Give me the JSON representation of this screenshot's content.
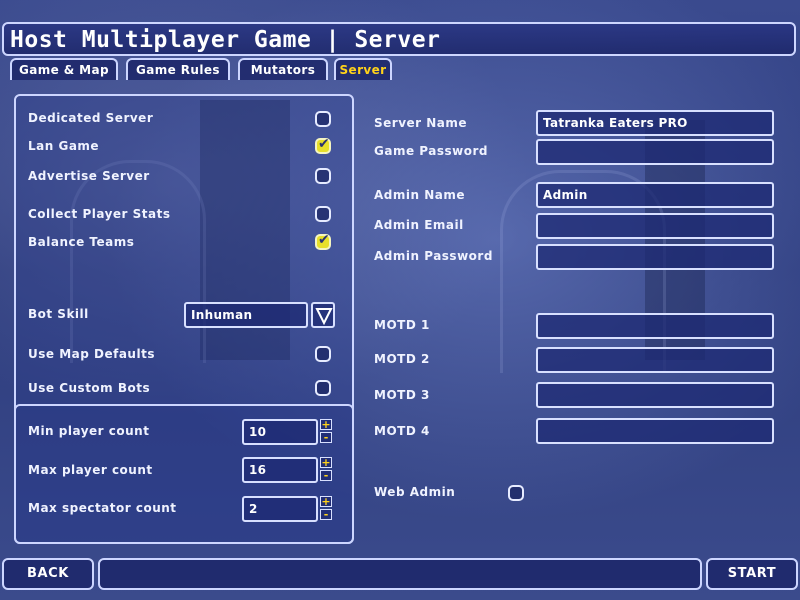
{
  "header": {
    "title": "Host Multiplayer Game | Server"
  },
  "tabs": [
    {
      "label": "Game & Map"
    },
    {
      "label": "Game Rules"
    },
    {
      "label": "Mutators"
    },
    {
      "label": "Server",
      "active": true
    }
  ],
  "left": {
    "dedicated_server": {
      "label": "Dedicated Server",
      "checked": false
    },
    "lan_game": {
      "label": "Lan Game",
      "checked": true
    },
    "advertise_server": {
      "label": "Advertise Server",
      "checked": false
    },
    "collect_stats": {
      "label": "Collect Player Stats",
      "checked": false
    },
    "balance_teams": {
      "label": "Balance Teams",
      "checked": true
    },
    "bot_skill": {
      "label": "Bot Skill",
      "value": "Inhuman"
    },
    "use_map_defaults": {
      "label": "Use Map Defaults",
      "checked": false
    },
    "use_custom_bots": {
      "label": "Use Custom Bots",
      "checked": false
    },
    "min_player": {
      "label": "Min player count",
      "value": "10"
    },
    "max_player": {
      "label": "Max player count",
      "value": "16"
    },
    "max_spectator": {
      "label": "Max spectator count",
      "value": "2"
    },
    "spin_plus": "+",
    "spin_minus": "-"
  },
  "right": {
    "server_name": {
      "label": "Server Name",
      "value": "Tatranka Eaters PRO"
    },
    "game_password": {
      "label": "Game Password",
      "value": ""
    },
    "admin_name": {
      "label": "Admin Name",
      "value": "Admin"
    },
    "admin_email": {
      "label": "Admin Email",
      "value": ""
    },
    "admin_password": {
      "label": "Admin Password",
      "value": ""
    },
    "motd1": {
      "label": "MOTD 1",
      "value": ""
    },
    "motd2": {
      "label": "MOTD 2",
      "value": ""
    },
    "motd3": {
      "label": "MOTD 3",
      "value": ""
    },
    "motd4": {
      "label": "MOTD 4",
      "value": ""
    },
    "web_admin": {
      "label": "Web Admin",
      "checked": false
    }
  },
  "footer": {
    "back_label": "BACK",
    "start_label": "START",
    "status": ""
  },
  "colors": {
    "accent": "#ffd21a",
    "checkbox_on": "#e8e02a",
    "border": "#cdd6ff"
  }
}
